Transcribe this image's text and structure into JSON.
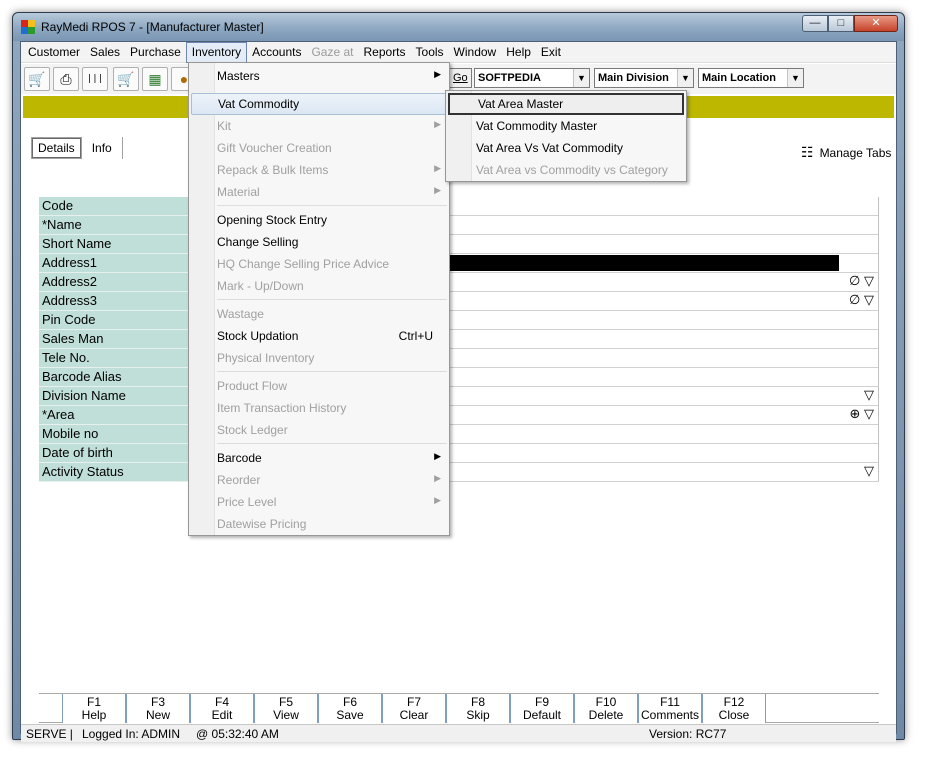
{
  "window": {
    "title": "RayMedi RPOS 7 - [Manufacturer Master]",
    "controls": [
      "minimize-icon",
      "maximize-icon",
      "close-icon"
    ]
  },
  "menubar": [
    "Customer",
    "Sales",
    "Purchase",
    "Inventory",
    "Accounts",
    "Gaze at",
    "Reports",
    "Tools",
    "Window",
    "Help",
    "Exit"
  ],
  "toolbar": {
    "go_label": "Go",
    "company": "SOFTPEDIA",
    "division": "Main Division",
    "location": "Main Location"
  },
  "tabs": {
    "details": "Details",
    "info": "Info",
    "manage": "Manage Tabs"
  },
  "form_labels": [
    "Code",
    "*Name",
    "Short Name",
    "Address1",
    "Address2",
    "Address3",
    "Pin Code",
    "Sales Man",
    "Tele No.",
    "Barcode Alias",
    "Division Name",
    "*Area",
    "Mobile no",
    "Date of birth",
    "Activity Status"
  ],
  "inventory_menu": {
    "masters": "Masters",
    "vat_commodity": "Vat Commodity",
    "kit": "Kit",
    "gift_voucher": "Gift Voucher Creation",
    "repack": "Repack & Bulk Items",
    "material": "Material",
    "opening_stock": "Opening Stock Entry",
    "change_selling": "Change Selling",
    "hq_change": "HQ Change Selling Price Advice",
    "mark_updown": "Mark - Up/Down",
    "wastage": "Wastage",
    "stock_updation": "Stock Updation",
    "stock_updation_shortcut": "Ctrl+U",
    "physical_inventory": "Physical Inventory",
    "product_flow": "Product Flow",
    "item_transaction": "Item Transaction History",
    "stock_ledger": "Stock Ledger",
    "barcode": "Barcode",
    "reorder": "Reorder",
    "price_level": "Price Level",
    "datewise_pricing": "Datewise Pricing"
  },
  "vat_submenu": {
    "vat_area_master": "Vat Area Master",
    "vat_commodity_master": "Vat Commodity Master",
    "vat_area_vs_vat_commodity": "Vat Area Vs Vat Commodity",
    "vat_area_vs_commodity_vs_category": "Vat Area vs Commodity vs Category"
  },
  "fkeys": [
    {
      "key": "F1",
      "label": "Help"
    },
    {
      "key": "F3",
      "label": "New"
    },
    {
      "key": "F4",
      "label": "Edit"
    },
    {
      "key": "F5",
      "label": "View"
    },
    {
      "key": "F6",
      "label": "Save"
    },
    {
      "key": "F7",
      "label": "Clear"
    },
    {
      "key": "F8",
      "label": "Skip"
    },
    {
      "key": "F9",
      "label": "Default"
    },
    {
      "key": "F10",
      "label": "Delete"
    },
    {
      "key": "F11",
      "label": "Comments"
    },
    {
      "key": "F12",
      "label": "Close"
    }
  ],
  "status": {
    "server": "SERVE |",
    "logged_in": "Logged In: ADMIN",
    "time": "@ 05:32:40 AM",
    "version": "Version: RC77"
  },
  "colors": {
    "accent_band": "#bdb700",
    "label_bg": "#c0dfd8"
  }
}
